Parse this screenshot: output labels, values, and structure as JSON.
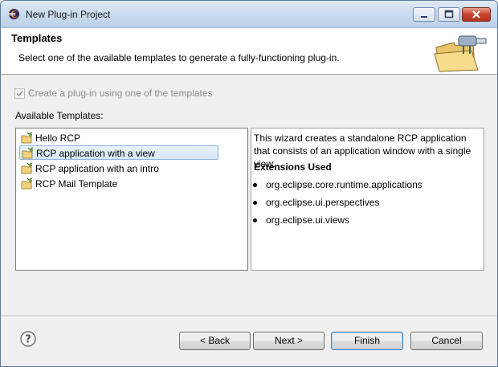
{
  "window": {
    "title": "New Plug-in Project"
  },
  "header": {
    "title": "Templates",
    "description": "Select one of the available templates to generate a fully-functioning plug-in."
  },
  "template_checkbox": {
    "label": "Create a plug-in using one of the templates",
    "checked": true,
    "enabled": false
  },
  "available_label": "Available Templates:",
  "templates": {
    "items": [
      {
        "label": "Hello RCP",
        "icon": "plugin-template-icon",
        "selected": false
      },
      {
        "label": "RCP application with a view",
        "icon": "plugin-template-icon",
        "selected": true
      },
      {
        "label": "RCP application with an intro",
        "icon": "plugin-template-icon",
        "selected": false
      },
      {
        "label": "RCP Mail Template",
        "icon": "plugin-template-icon",
        "selected": false
      }
    ]
  },
  "description": {
    "text": "This wizard creates a standalone RCP application that consists of an application window with a single view.",
    "extensions_heading": "Extensions Used",
    "extensions": [
      "org.eclipse.core.runtime.applications",
      "org.eclipse.ui.perspectives",
      "org.eclipse.ui.views"
    ]
  },
  "buttons": {
    "back": "< Back",
    "next": "Next >",
    "finish": "Finish",
    "cancel": "Cancel",
    "help_icon": "help-icon"
  },
  "colors": {
    "selection_fill": "#d6e8f9",
    "selection_border": "#8fb4df",
    "dialog_bg": "#f0f0f0"
  }
}
